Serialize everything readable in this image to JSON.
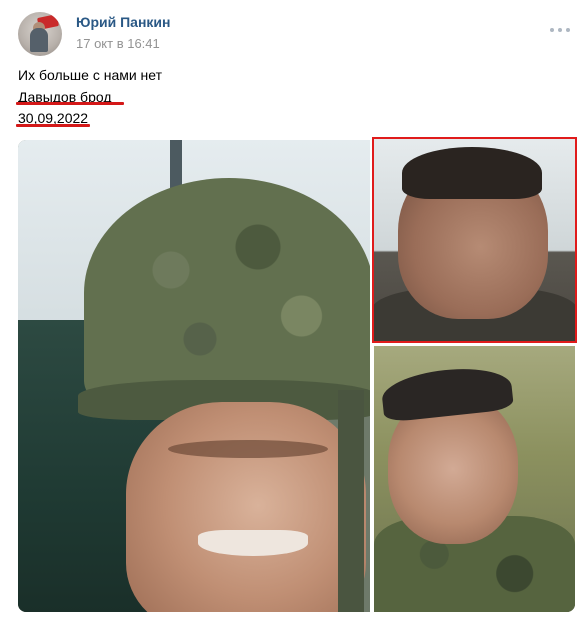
{
  "post": {
    "author": "Юрий Панкин",
    "date": "17 окт в 16:41",
    "text_lines": [
      "Их больше с нами нет",
      "Давыдов брод",
      "30,09,2022"
    ]
  },
  "icons": {
    "more": "more-horizontal-icon"
  },
  "colors": {
    "link": "#2a5885",
    "meta": "#939393",
    "highlight": "#e01b1b"
  }
}
